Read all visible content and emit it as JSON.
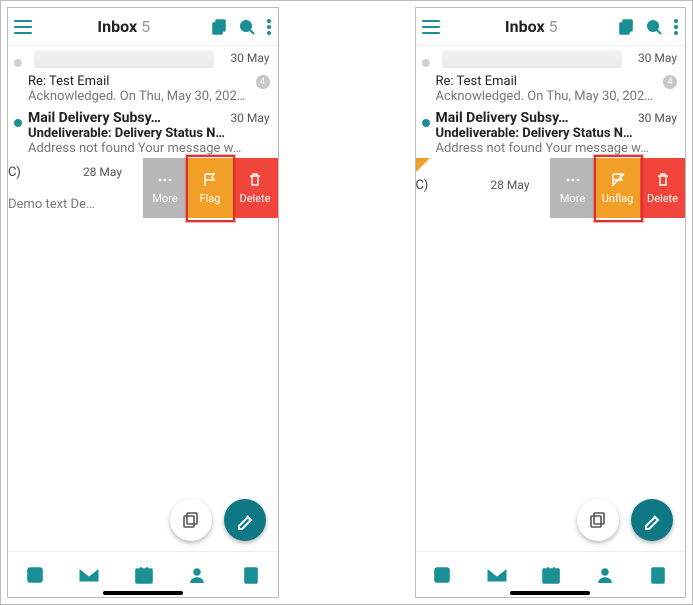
{
  "header": {
    "title": "Inbox",
    "count": "5"
  },
  "msgs": [
    {
      "sender": "",
      "date": "30 May",
      "subject": "Re: Test Email",
      "preview": "Acknowledged. On Thu, May 30, 202…",
      "thread": "4"
    },
    {
      "sender": "Mail Delivery Subsy…",
      "date": "30 May",
      "subject": "Undeliverable: Delivery Status N…",
      "preview": "Address not found Your message w…"
    }
  ],
  "swipe_left": {
    "c": "C)",
    "date": "28 May",
    "preview": "Demo text De…"
  },
  "swipe_right": {
    "c": "C)",
    "date": "28 May",
    "preview": ""
  },
  "actions_left": {
    "more": "More",
    "flag": "Flag",
    "del": "Delete"
  },
  "actions_right": {
    "more": "More",
    "flag": "Unflag",
    "del": "Delete"
  }
}
